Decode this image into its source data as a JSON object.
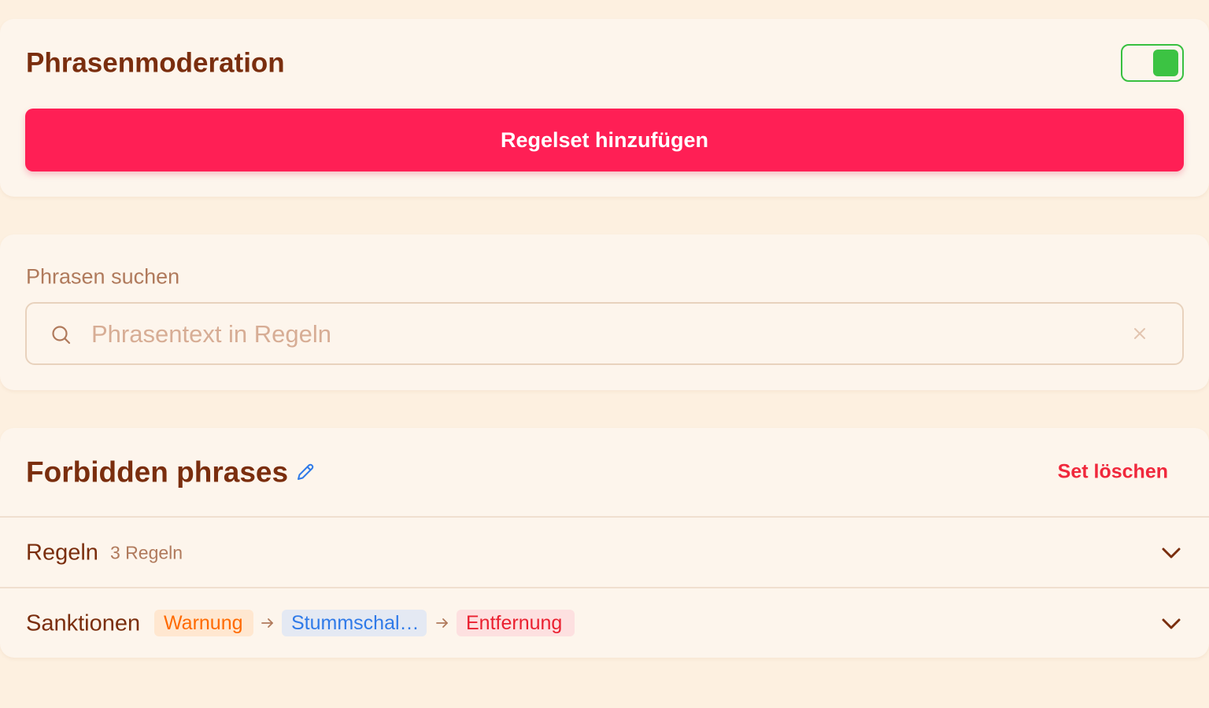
{
  "moderation": {
    "title": "Phrasenmoderation",
    "toggle_state": "on",
    "add_button_label": "Regelset hinzufügen"
  },
  "search": {
    "label": "Phrasen suchen",
    "placeholder": "Phrasentext in Regeln",
    "value": ""
  },
  "ruleset": {
    "title": "Forbidden phrases",
    "delete_label": "Set löschen",
    "rules_row": {
      "label": "Regeln",
      "count": "3 Regeln"
    },
    "sanctions_row": {
      "label": "Sanktionen",
      "chips": [
        "Warnung",
        "Stummschal…",
        "Entfernung"
      ]
    }
  },
  "colors": {
    "accent": "#ff1f55",
    "toggle_on": "#3cc343",
    "title_text": "#7a2e0e",
    "danger": "#f0283c",
    "edit_blue": "#2f7ae8",
    "background": "#fdf0e0",
    "card": "#fdf5ec"
  },
  "icons": [
    "search-icon",
    "clear-icon",
    "edit-pencil-icon",
    "chevron-down-icon",
    "arrow-right-icon"
  ]
}
